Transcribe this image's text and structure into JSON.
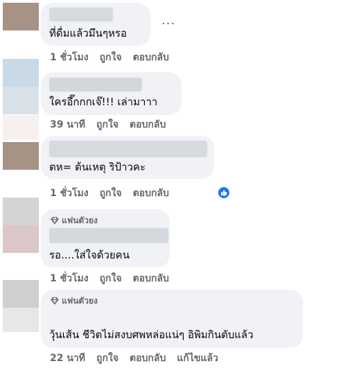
{
  "comments": [
    {
      "text": "ที่ดื่มแล้วมึนๆหรอ",
      "time": "1 ชั่วโมง",
      "like": "ถูกใจ",
      "reply": "ตอบกลับ"
    },
    {
      "text": "ใครอึ๊กกกเจ๊!!! เล่ามาาา",
      "time": "39 นาที",
      "like": "ถูกใจ",
      "reply": "ตอบกลับ"
    },
    {
      "text": "ตห= ต้นเหตุ ริป้าวคะ",
      "time": "1 ชั่วโมง",
      "like": "ถูกใจ",
      "reply": "ตอบกลับ"
    },
    {
      "badge": "แฟนตัวยง",
      "text": "รอ....ใส่ใจด้วยคน",
      "time": "1 ชั่วโมง",
      "like": "ถูกใจ",
      "reply": "ตอบกลับ"
    },
    {
      "badge": "แฟนตัวยง",
      "text": "วุ้นเส้น ชีวิตไม่สงบศพหล่อแน่ๆ อิพิมกินตับแล้ว",
      "time": "22 นาที",
      "like": "ถูกใจ",
      "reply": "ตอบกลับ",
      "edited": "แก้ไขแล้ว"
    }
  ],
  "icons": {
    "more": "more-options-icon",
    "like_reaction": "like-reaction-icon",
    "top_fan": "diamond-icon"
  },
  "colors": {
    "bubble": "#f0f2f5",
    "meta_text": "#65676b",
    "like_blue": "#1877f2"
  }
}
